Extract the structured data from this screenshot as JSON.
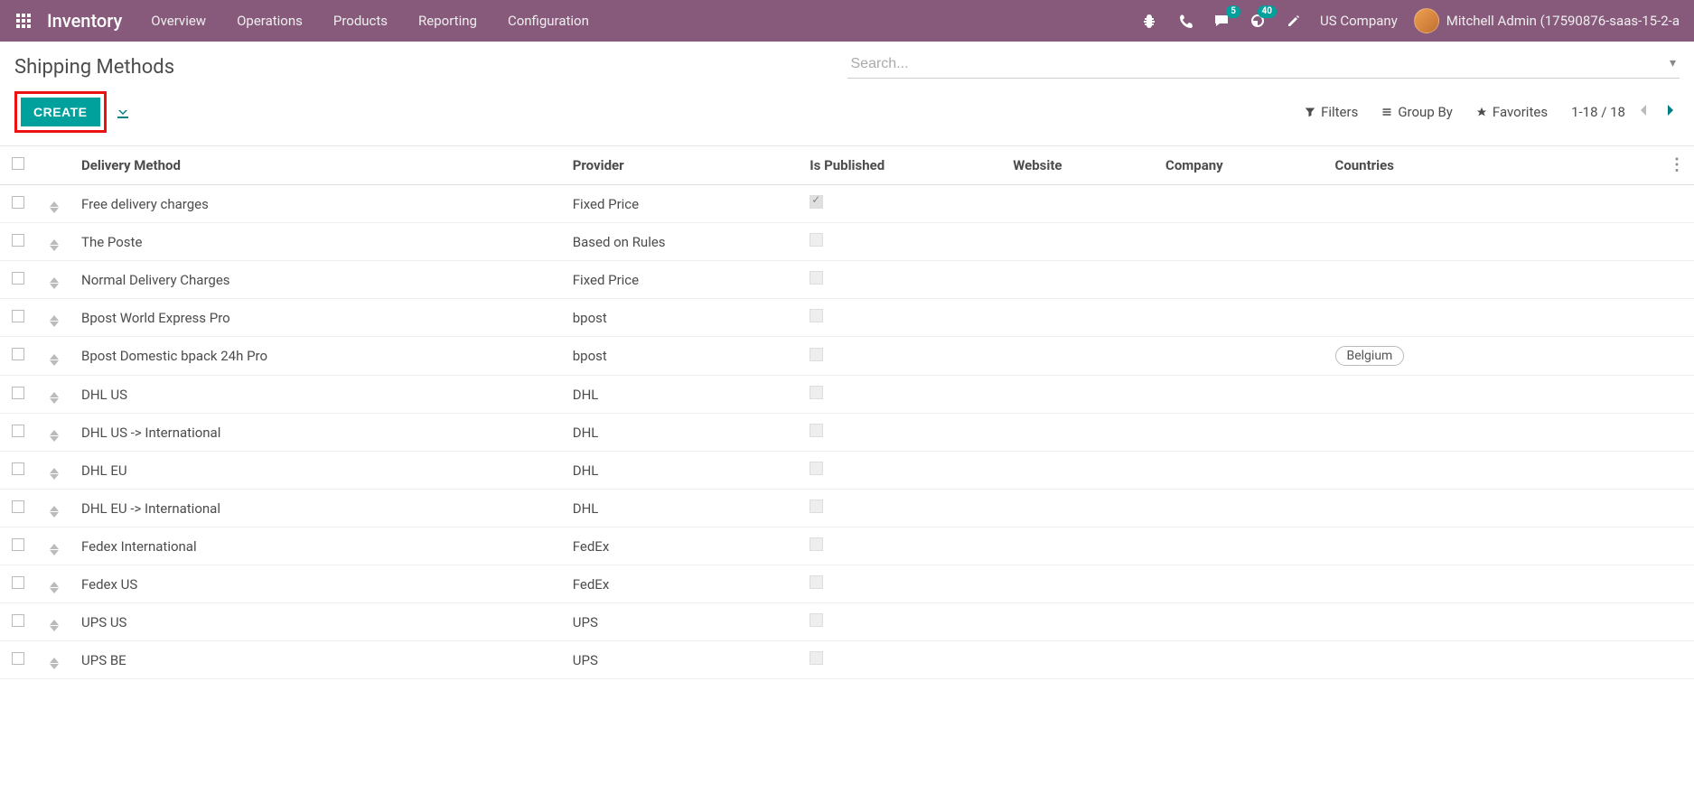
{
  "navbar": {
    "brand": "Inventory",
    "menu": [
      "Overview",
      "Operations",
      "Products",
      "Reporting",
      "Configuration"
    ],
    "messages_badge": "5",
    "activities_badge": "40",
    "company": "US Company",
    "user": "Mitchell Admin (17590876-saas-15-2-a"
  },
  "breadcrumb": "Shipping Methods",
  "search": {
    "placeholder": "Search..."
  },
  "buttons": {
    "create": "CREATE"
  },
  "filters": {
    "filters": "Filters",
    "group_by": "Group By",
    "favorites": "Favorites"
  },
  "pager": {
    "range": "1-18 / 18"
  },
  "columns": {
    "method": "Delivery Method",
    "provider": "Provider",
    "published": "Is Published",
    "website": "Website",
    "company": "Company",
    "countries": "Countries"
  },
  "rows": [
    {
      "method": "Free delivery charges",
      "provider": "Fixed Price",
      "published": true,
      "countries": []
    },
    {
      "method": "The Poste",
      "provider": "Based on Rules",
      "published": false,
      "countries": []
    },
    {
      "method": "Normal Delivery Charges",
      "provider": "Fixed Price",
      "published": false,
      "countries": []
    },
    {
      "method": "Bpost World Express Pro",
      "provider": "bpost",
      "published": false,
      "countries": []
    },
    {
      "method": "Bpost Domestic bpack 24h Pro",
      "provider": "bpost",
      "published": false,
      "countries": [
        "Belgium"
      ]
    },
    {
      "method": "DHL US",
      "provider": "DHL",
      "published": false,
      "countries": []
    },
    {
      "method": "DHL US -> International",
      "provider": "DHL",
      "published": false,
      "countries": []
    },
    {
      "method": "DHL EU",
      "provider": "DHL",
      "published": false,
      "countries": []
    },
    {
      "method": "DHL EU -> International",
      "provider": "DHL",
      "published": false,
      "countries": []
    },
    {
      "method": "Fedex International",
      "provider": "FedEx",
      "published": false,
      "countries": []
    },
    {
      "method": "Fedex US",
      "provider": "FedEx",
      "published": false,
      "countries": []
    },
    {
      "method": "UPS US",
      "provider": "UPS",
      "published": false,
      "countries": []
    },
    {
      "method": "UPS BE",
      "provider": "UPS",
      "published": false,
      "countries": []
    }
  ]
}
